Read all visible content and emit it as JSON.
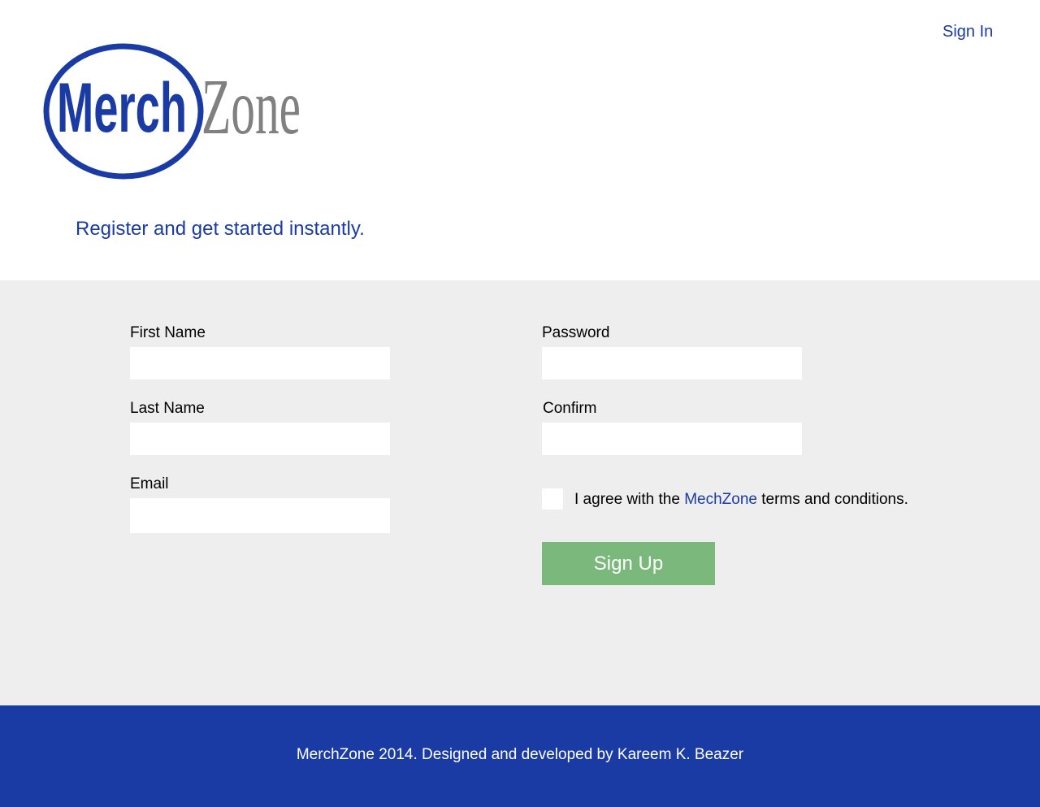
{
  "header": {
    "sign_in_label": "Sign In",
    "logo": {
      "word_1": "Merch",
      "word_2": "Zone"
    },
    "tagline": "Register and get started instantly."
  },
  "form": {
    "first_name_label": "First Name",
    "last_name_label": "Last Name",
    "email_label": "Email",
    "password_label": "Password",
    "confirm_label": "Confirm",
    "first_name_value": "",
    "last_name_value": "",
    "email_value": "",
    "password_value": "",
    "confirm_value": "",
    "agree_prefix": "I agree with the ",
    "agree_link": "MechZone",
    "agree_suffix": " terms and conditions.",
    "terms_checked": false,
    "signup_label": "Sign Up"
  },
  "footer": {
    "text": "MerchZone 2014. Designed and developed by Kareem K. Beazer"
  },
  "colors": {
    "brand_blue": "#1a3aa4",
    "logo_gray": "#808080",
    "form_bg": "#eeeeee",
    "signup_green": "#7bb87b"
  }
}
